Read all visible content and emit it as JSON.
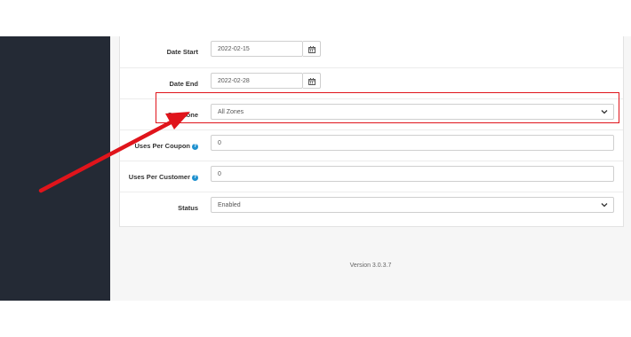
{
  "form": {
    "rows": [
      {
        "label": "Date Start",
        "value": "2022-02-15"
      },
      {
        "label": "Date End",
        "value": "2022-02-28"
      },
      {
        "label": "Geo Zone",
        "value": "All Zones"
      },
      {
        "label": "Uses Per Coupon",
        "value": "0"
      },
      {
        "label": "Uses Per Customer",
        "value": "0"
      },
      {
        "label": "Status",
        "value": "Enabled"
      }
    ]
  },
  "footer": {
    "version": "Version 3.0.3.7"
  },
  "colors": {
    "sidebar": "#242a35",
    "highlight": "#e0141b",
    "info": "#1e91cf"
  },
  "icons": {
    "calendar": "calendar-icon",
    "dropdown": "chevron-down-icon",
    "help": "info-icon"
  }
}
